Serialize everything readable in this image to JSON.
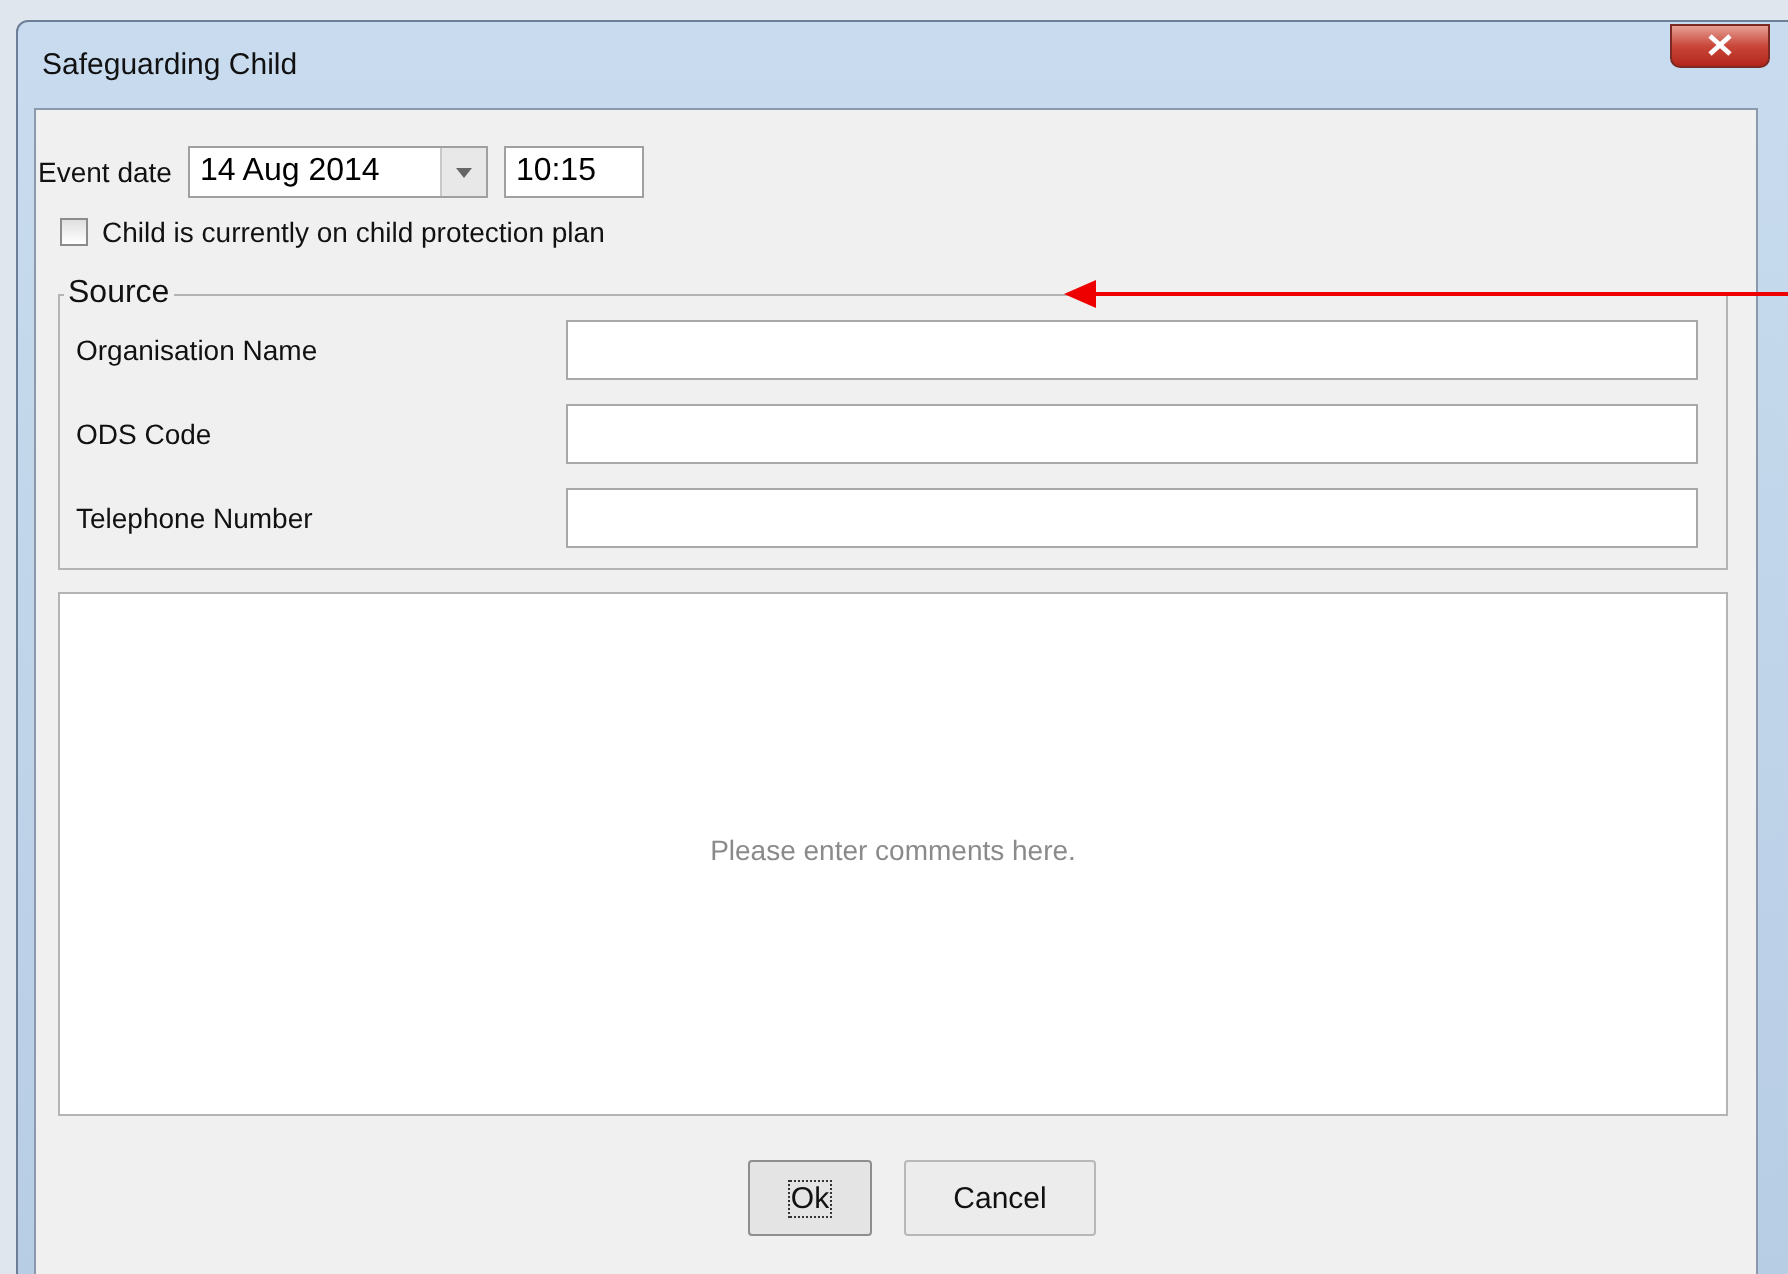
{
  "window": {
    "title": "Safeguarding Child"
  },
  "event": {
    "label": "Event date",
    "date": "14 Aug 2014",
    "time": "10:15"
  },
  "protection_plan": {
    "label": "Child is currently on child protection plan",
    "checked": false
  },
  "source": {
    "title": "Source",
    "fields": [
      {
        "label": "Organisation Name"
      },
      {
        "label": "ODS Code"
      },
      {
        "label": "Telephone Number"
      }
    ]
  },
  "comments": {
    "placeholder": "Please enter comments here."
  },
  "buttons": [
    {
      "label": "Ok",
      "focused": true
    },
    {
      "label": "Cancel",
      "focused": false
    }
  ]
}
